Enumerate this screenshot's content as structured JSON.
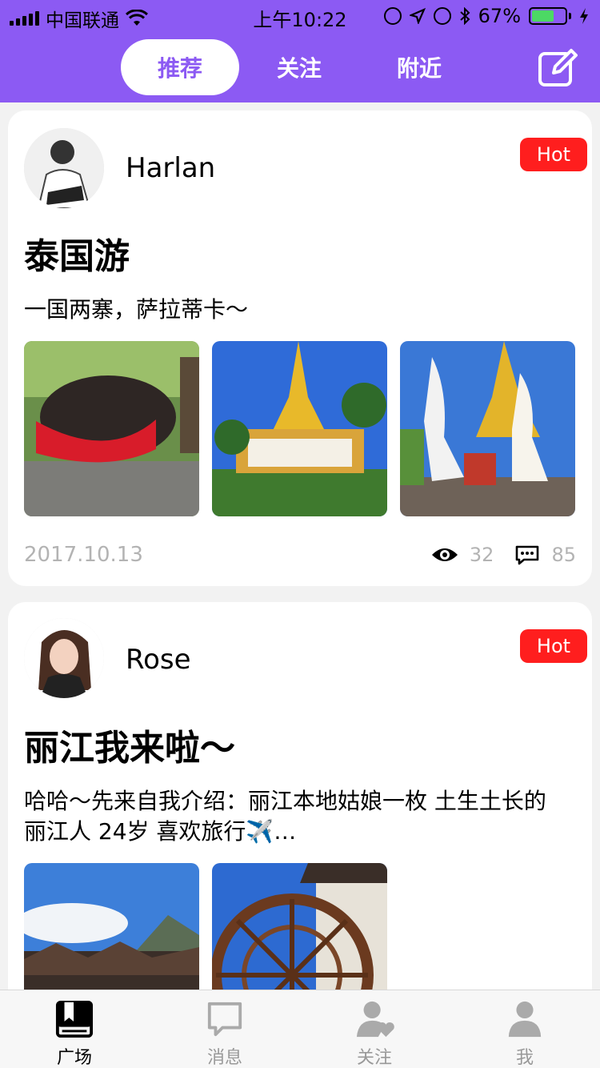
{
  "status_bar": {
    "carrier": "中国联通",
    "time": "上午10:22",
    "battery": "67%",
    "battery_level": 0.67
  },
  "nav": {
    "tabs": [
      {
        "label": "推荐",
        "active": true
      },
      {
        "label": "关注",
        "active": false
      },
      {
        "label": "附近",
        "active": false
      }
    ],
    "edit_icon": "edit-icon"
  },
  "posts": [
    {
      "author": "Harlan",
      "badge": "Hot",
      "title": "泰国游",
      "excerpt": "一国两寨，萨拉蒂卡～",
      "date": "2017.10.13",
      "views": "32",
      "comments": "85"
    },
    {
      "author": "Rose",
      "badge": "Hot",
      "title": "丽江我来啦～",
      "excerpt": "哈哈～先来自我介绍：丽江本地姑娘一枚 土生土长的丽江人 24岁 喜欢旅行✈️…"
    }
  ],
  "tabbar": {
    "items": [
      {
        "label": "广场",
        "icon": "book-icon",
        "active": true
      },
      {
        "label": "消息",
        "icon": "chat-bubble-icon",
        "active": false
      },
      {
        "label": "关注",
        "icon": "person-heart-icon",
        "active": false
      },
      {
        "label": "我",
        "icon": "person-icon",
        "active": false
      }
    ]
  },
  "colors": {
    "accent": "#8c5af3",
    "hot_badge": "#ff1e1e",
    "muted_text": "#b3b3b3",
    "background": "#f2f2f2"
  }
}
